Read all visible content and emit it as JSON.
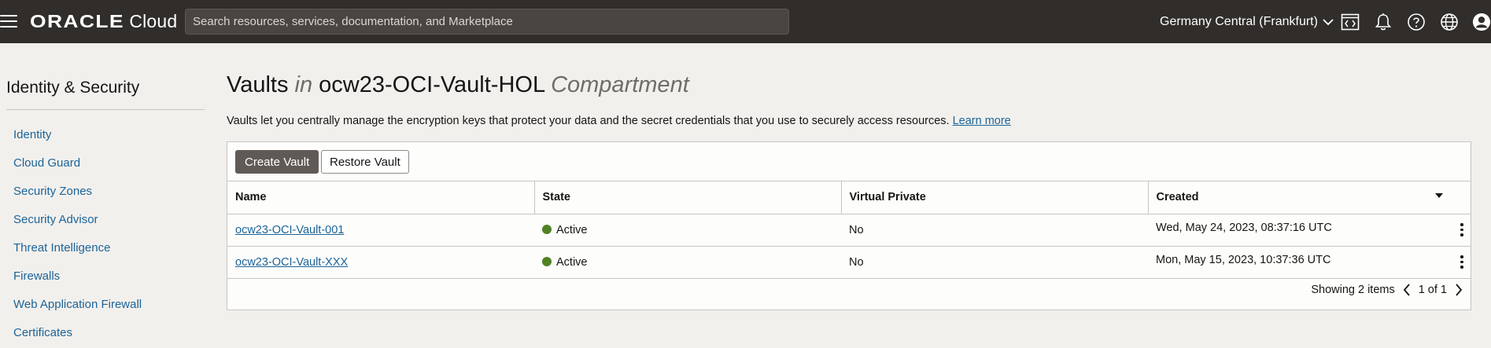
{
  "header": {
    "brand_oracle": "ORACLE",
    "brand_cloud": "Cloud",
    "search_placeholder": "Search resources, services, documentation, and Marketplace",
    "region": "Germany Central (Frankfurt)",
    "icons": [
      "code-editor-icon",
      "bell-icon",
      "help-icon",
      "globe-icon",
      "user-icon"
    ]
  },
  "sidebar": {
    "title": "Identity & Security",
    "items": [
      {
        "label": "Identity"
      },
      {
        "label": "Cloud Guard"
      },
      {
        "label": "Security Zones"
      },
      {
        "label": "Security Advisor"
      },
      {
        "label": "Threat Intelligence"
      },
      {
        "label": "Firewalls"
      },
      {
        "label": "Web Application Firewall"
      },
      {
        "label": "Certificates"
      }
    ]
  },
  "main": {
    "title_main": "Vaults",
    "title_in": "in",
    "title_compartment_name": "ocw23-OCI-Vault-HOL",
    "title_compartment_word": "Compartment",
    "description": "Vaults let you centrally manage the encryption keys that protect your data and the secret credentials that you use to securely access resources.",
    "learn_more": "Learn more",
    "toolbar": {
      "create_label": "Create Vault",
      "restore_label": "Restore Vault"
    },
    "table": {
      "columns": [
        "Name",
        "State",
        "Virtual Private",
        "Created"
      ],
      "rows": [
        {
          "name": "ocw23-OCI-Vault-001",
          "state": "Active",
          "virtual_private": "No",
          "created": "Wed, May 24, 2023, 08:37:16 UTC"
        },
        {
          "name": "ocw23-OCI-Vault-XXX",
          "state": "Active",
          "virtual_private": "No",
          "created": "Mon, May 15, 2023, 10:37:36 UTC"
        }
      ]
    },
    "pager": {
      "showing": "Showing 2 items",
      "page": "1 of 1"
    }
  },
  "colors": {
    "header_bg": "#312d2a",
    "link": "#1c6497",
    "active_status": "#508223",
    "primary_button": "#5f5a55"
  }
}
